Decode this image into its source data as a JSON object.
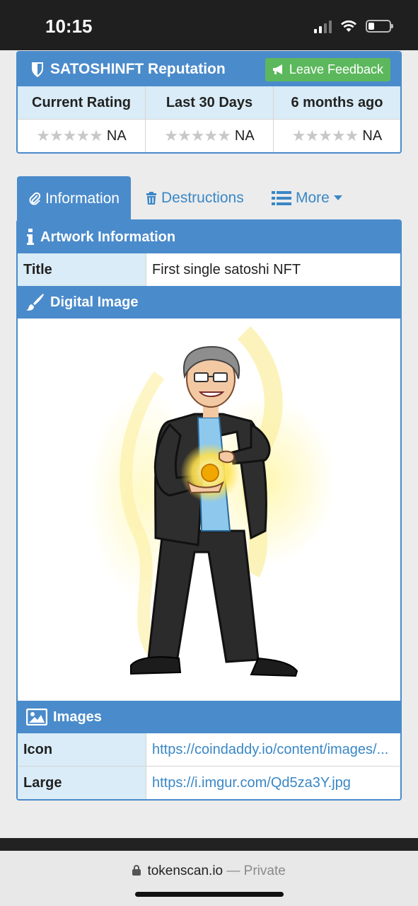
{
  "status": {
    "time": "10:15"
  },
  "reputation": {
    "title": "SATOSHINFT Reputation",
    "feedback_label": "Leave Feedback",
    "columns": [
      {
        "label": "Current Rating",
        "value": "NA"
      },
      {
        "label": "Last 30 Days",
        "value": "NA"
      },
      {
        "label": "6 months ago",
        "value": "NA"
      }
    ]
  },
  "tabs": {
    "information": "Information",
    "destructions": "Destructions",
    "more": "More"
  },
  "artwork": {
    "heading": "Artwork Information",
    "title_key": "Title",
    "title_value": "First single satoshi NFT"
  },
  "digital_image": {
    "heading": "Digital Image"
  },
  "images": {
    "heading": "Images",
    "rows": [
      {
        "key": "Icon",
        "value": "https://coindaddy.io/content/images/..."
      },
      {
        "key": "Large",
        "value": "https://i.imgur.com/Qd5za3Y.jpg"
      }
    ]
  },
  "browser": {
    "domain": "tokenscan.io",
    "mode": "— Private"
  }
}
